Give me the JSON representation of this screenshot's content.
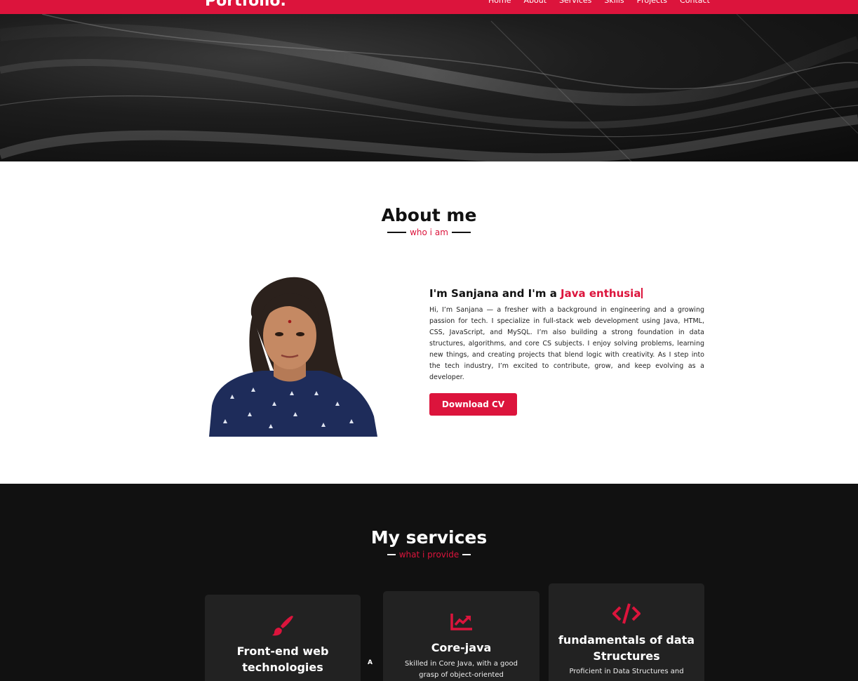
{
  "navbar": {
    "logo": "Portfolio.",
    "items": [
      "Home",
      "About",
      "Services",
      "Skills",
      "Projects",
      "Contact"
    ]
  },
  "about": {
    "title": "About me",
    "subtitle": "who i am",
    "heading_prefix": "I'm Sanjana and I'm a ",
    "heading_typed": "Java enthusia",
    "paragraph": "Hi, I’m Sanjana — a fresher with a background in engineering and a growing passion for tech. I specialize in full-stack web development using Java, HTML, CSS, JavaScript, and MySQL. I’m also building a strong foundation in data structures, algorithms, and core CS subjects. I enjoy solving problems, learning new things, and creating projects that blend logic with creativity. As I step into the tech industry, I’m excited to contribute, grow, and keep evolving as a developer.",
    "button_label": "Download CV"
  },
  "services": {
    "title": "My services",
    "subtitle": "what i provide",
    "scroll_marker": "A",
    "cards": [
      {
        "icon": "paint-brush-icon",
        "title": "Front-end web technologies",
        "desc": ""
      },
      {
        "icon": "chart-line-icon",
        "title": "Core-java",
        "desc": "Skilled in Core Java, with a good grasp of object-oriented"
      },
      {
        "icon": "code-icon",
        "title": "fundamentals of data Structures",
        "desc": "Proficient in Data Structures and"
      }
    ]
  },
  "colors": {
    "accent": "#dc143c",
    "dark_bg": "#111111",
    "card_bg": "#222222"
  }
}
